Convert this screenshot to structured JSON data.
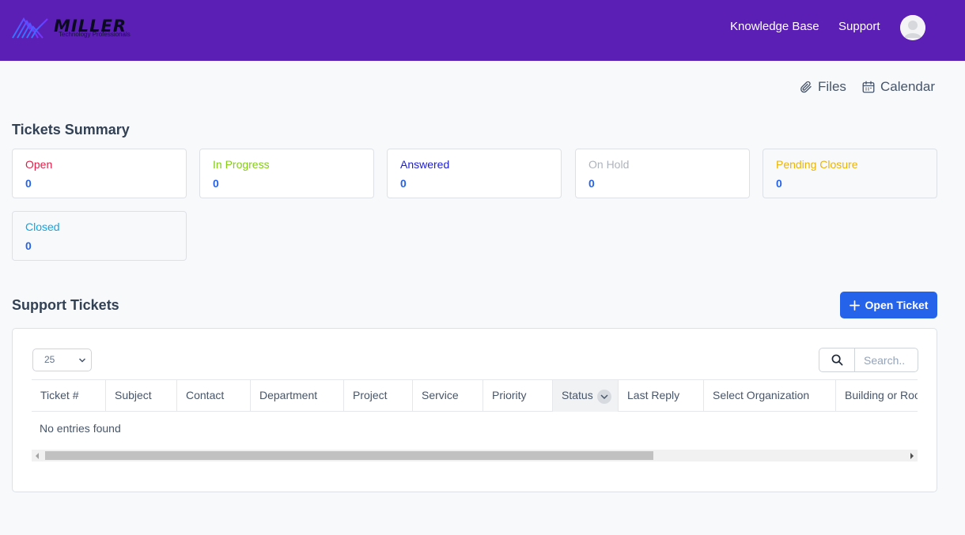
{
  "header": {
    "logo_text": "MILLER",
    "logo_subtext": "Technology Professionals",
    "nav": [
      "Knowledge Base",
      "Support"
    ],
    "avatar_icon": "user-avatar-icon"
  },
  "toolbar": {
    "files": {
      "label": "Files",
      "icon": "paperclip-icon"
    },
    "calendar": {
      "label": "Calendar",
      "icon": "calendar-icon"
    }
  },
  "summary": {
    "title": "Tickets Summary",
    "cards": [
      {
        "label": "Open",
        "count": "0",
        "color": "#e11d48"
      },
      {
        "label": "In Progress",
        "count": "0",
        "color": "#84cc16"
      },
      {
        "label": "Answered",
        "count": "0",
        "color": "#1d1dd6"
      },
      {
        "label": "On Hold",
        "count": "0",
        "color": "#aeb4bc"
      },
      {
        "label": "Pending Closure",
        "count": "0",
        "color": "#eab308"
      },
      {
        "label": "Closed",
        "count": "0",
        "color": "#0ea5e9"
      }
    ]
  },
  "tickets": {
    "title": "Support Tickets",
    "open_button": "Open Ticket",
    "page_length": "25",
    "search_placeholder": "Search..",
    "columns": [
      "Ticket #",
      "Subject",
      "Contact",
      "Department",
      "Project",
      "Service",
      "Priority",
      "Status",
      "Last Reply",
      "Select Organization",
      "Building or Room"
    ],
    "sorted_column": "Status",
    "empty_message": "No entries found"
  },
  "colors": {
    "header_bg": "#5c1fb6",
    "primary": "#2563eb"
  }
}
